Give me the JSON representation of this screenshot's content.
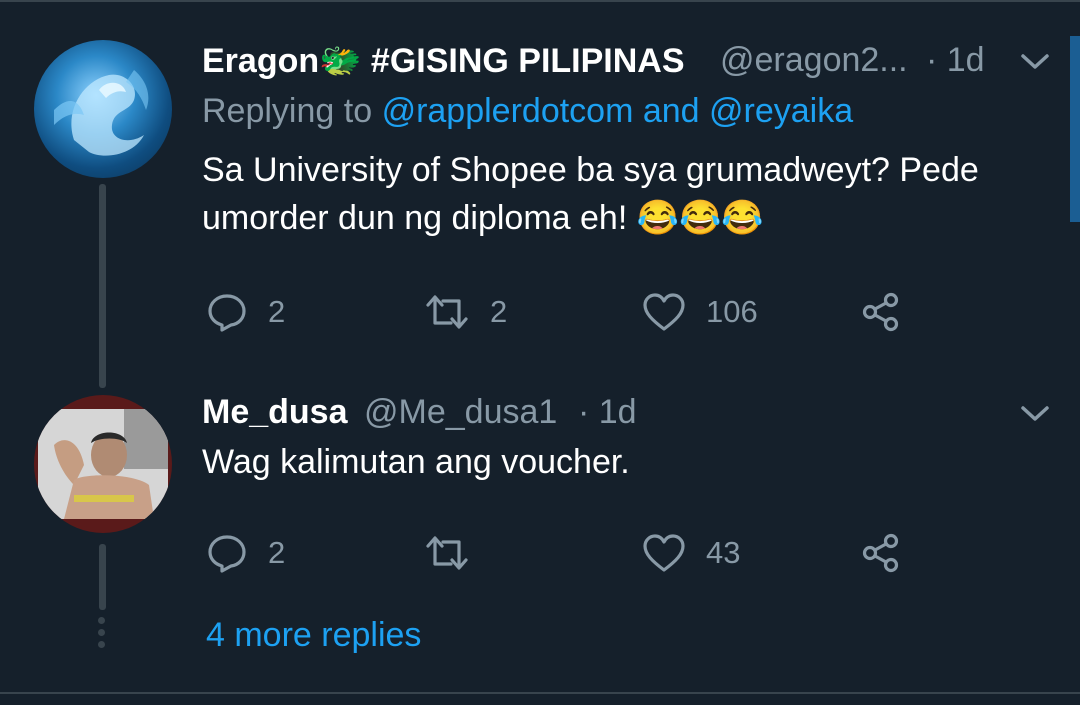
{
  "colors": {
    "background": "#15202b",
    "text": "#ffffff",
    "muted": "#8899a6",
    "accent": "#1da1f2",
    "divider": "#38444d"
  },
  "tweets": [
    {
      "display_name": "Eragon🐲 #GISING PILIPINAS",
      "handle": "@eragon2...",
      "time": "· 1d",
      "replying_prefix": "Replying to",
      "replying_to": "@rapplerdotcom and @reyaika",
      "text": "Sa University of Shopee ba sya grumadweyt? Pede umorder dun ng diploma eh! 😂😂😂",
      "replies": "2",
      "retweets": "2",
      "likes": "106",
      "avatar_icon": "dragon-avatar"
    },
    {
      "display_name": "Me_dusa",
      "handle": "@Me_dusa1",
      "time": "· 1d",
      "text": "Wag kalimutan ang voucher.",
      "replies": "2",
      "retweets": "",
      "likes": "43",
      "avatar_icon": "person-photo-avatar"
    }
  ],
  "more_replies": "4 more replies",
  "icons": [
    "reply-icon",
    "retweet-icon",
    "like-icon",
    "share-icon",
    "chevron-down-icon"
  ]
}
